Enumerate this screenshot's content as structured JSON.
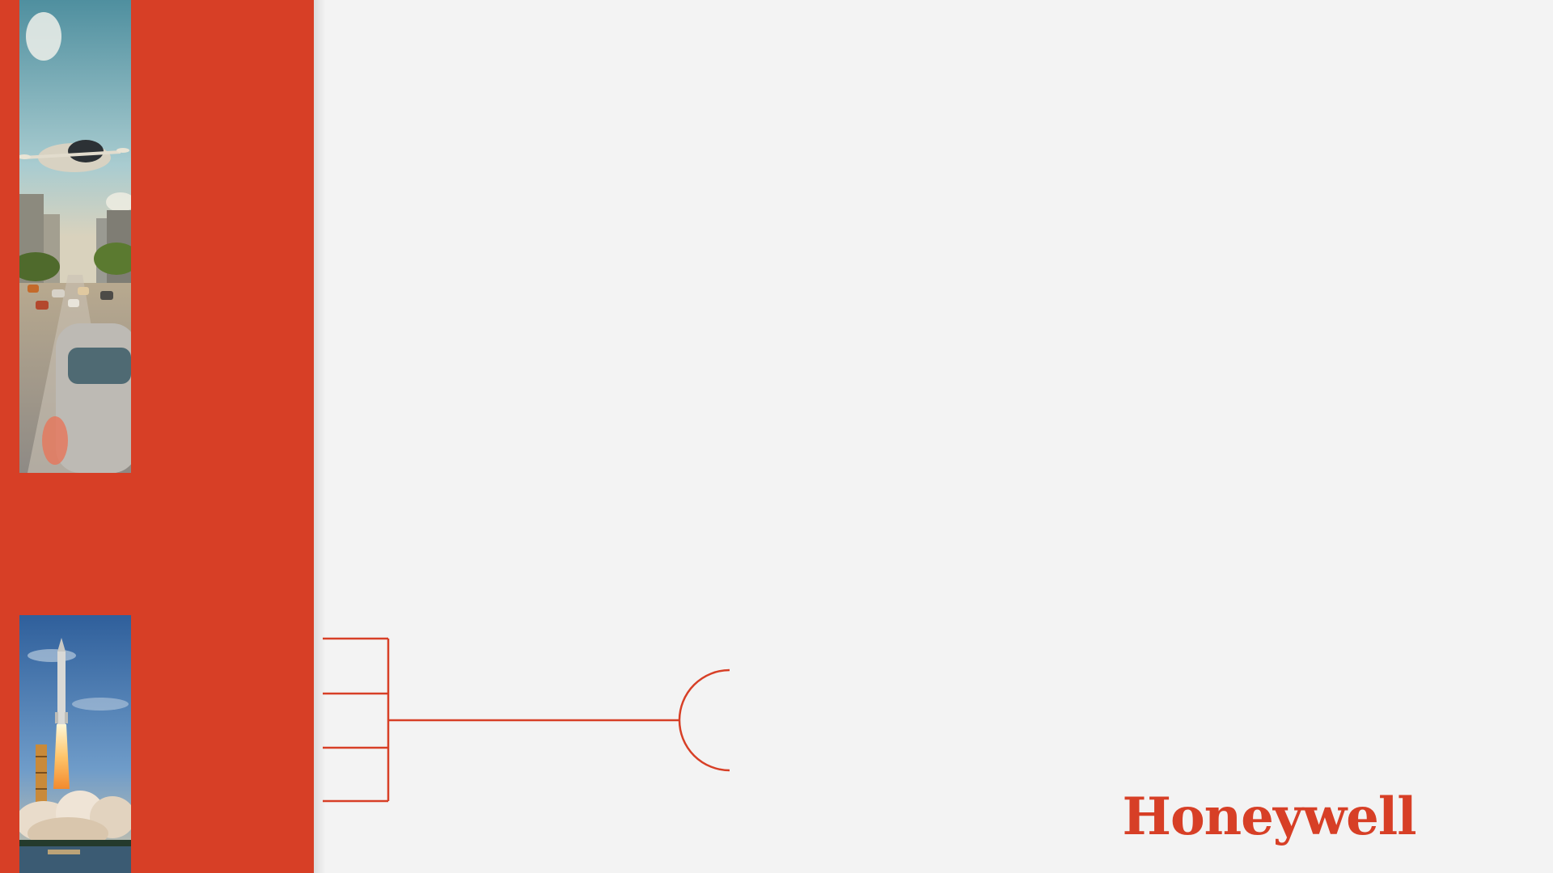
{
  "slide": {
    "brand": {
      "logo_text": "Honeywell",
      "color": "#d73f26"
    },
    "background_color": "#f3f3f3",
    "sidebar_color": "#d73f26",
    "images": [
      {
        "name": "city-traffic-flying-vehicle-image"
      },
      {
        "name": "rocket-launch-image"
      }
    ]
  }
}
